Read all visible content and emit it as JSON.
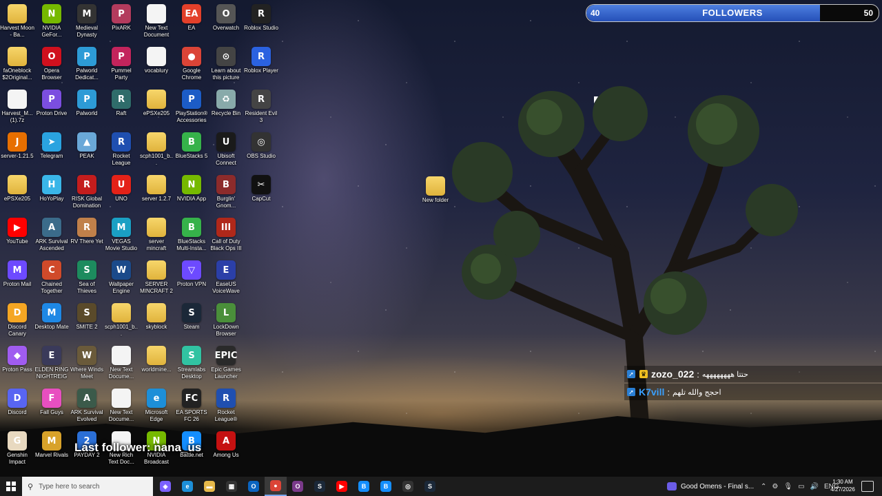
{
  "desktop": {
    "icons": [
      {
        "label": "Harvest Moon - Ba...",
        "glyph": "",
        "color": "#e6b94a",
        "kind": "folder"
      },
      {
        "label": "NVIDIA GeFor...",
        "glyph": "N",
        "color": "#76b900"
      },
      {
        "label": "Medieval Dynasty",
        "glyph": "M",
        "color": "#333"
      },
      {
        "label": "PixARK",
        "glyph": "P",
        "color": "#b33b5d"
      },
      {
        "label": "New Text Document",
        "glyph": "",
        "color": "#eee",
        "kind": "doc"
      },
      {
        "label": "EA",
        "glyph": "EA",
        "color": "#e3402a"
      },
      {
        "label": "Overwatch",
        "glyph": "O",
        "color": "#555"
      },
      {
        "label": "Roblox Studio",
        "glyph": "R",
        "color": "#222"
      },
      {
        "label": "faOneblock $2Original...",
        "glyph": "",
        "color": "#e6b94a",
        "kind": "folder"
      },
      {
        "label": "Opera Browser",
        "glyph": "O",
        "color": "#d0101e"
      },
      {
        "label": "Palworld Dedicat...",
        "glyph": "P",
        "color": "#2d9bd6"
      },
      {
        "label": "Pummel Party",
        "glyph": "P",
        "color": "#c3245c"
      },
      {
        "label": "vocablury",
        "glyph": "",
        "color": "#eee",
        "kind": "doc"
      },
      {
        "label": "Google Chrome",
        "glyph": "●",
        "color": "#db4437"
      },
      {
        "label": "Learn about this picture",
        "glyph": "⊙",
        "color": "#444"
      },
      {
        "label": "Roblox Player",
        "glyph": "R",
        "color": "#2b62e0"
      },
      {
        "label": "Harvest_M... (1).7z",
        "glyph": "",
        "color": "#eee",
        "kind": "doc"
      },
      {
        "label": "Proton Drive",
        "glyph": "P",
        "color": "#7b4ee0"
      },
      {
        "label": "Palworld",
        "glyph": "P",
        "color": "#2d9bd6"
      },
      {
        "label": "Raft",
        "glyph": "R",
        "color": "#2f6c6a"
      },
      {
        "label": "ePSXe205",
        "glyph": "",
        "color": "#e6b94a",
        "kind": "folder"
      },
      {
        "label": "PlayStation® Accessories",
        "glyph": "P",
        "color": "#1c5cc6"
      },
      {
        "label": "Recycle Bin",
        "glyph": "♻",
        "color": "#8aa"
      },
      {
        "label": "Resident Evil 3",
        "glyph": "R",
        "color": "#444"
      },
      {
        "label": "server-1.21.5",
        "glyph": "J",
        "color": "#e76f00"
      },
      {
        "label": "Telegram",
        "glyph": "➤",
        "color": "#2aa3e0"
      },
      {
        "label": "PEAK",
        "glyph": "▲",
        "color": "#6aa8d8"
      },
      {
        "label": "Rocket League",
        "glyph": "R",
        "color": "#1f4fb0"
      },
      {
        "label": "scph1001_b...",
        "glyph": "",
        "color": "#e6b94a",
        "kind": "folder"
      },
      {
        "label": "BlueStacks 5",
        "glyph": "B",
        "color": "#36b24a"
      },
      {
        "label": "Ubisoft Connect",
        "glyph": "U",
        "color": "#1a1a1a"
      },
      {
        "label": "OBS Studio",
        "glyph": "◎",
        "color": "#333"
      },
      {
        "label": "ePSXe205",
        "glyph": "",
        "color": "#e6b94a",
        "kind": "folder"
      },
      {
        "label": "HoYoPlay",
        "glyph": "H",
        "color": "#3ab6e8"
      },
      {
        "label": "RISK Global Domination",
        "glyph": "R",
        "color": "#c41d1d"
      },
      {
        "label": "UNO",
        "glyph": "U",
        "color": "#e42218"
      },
      {
        "label": "server 1.2.7",
        "glyph": "",
        "color": "#e6b94a",
        "kind": "folder"
      },
      {
        "label": "NVIDIA App",
        "glyph": "N",
        "color": "#76b900"
      },
      {
        "label": "Burglin' Gnom...",
        "glyph": "B",
        "color": "#8c2b2b"
      },
      {
        "label": "CapCut",
        "glyph": "✂",
        "color": "#111"
      },
      {
        "label": "YouTube",
        "glyph": "▶",
        "color": "#ff0000"
      },
      {
        "label": "ARK Survival Ascended",
        "glyph": "A",
        "color": "#3b6b8a"
      },
      {
        "label": "RV There Yet",
        "glyph": "R",
        "color": "#c0804a"
      },
      {
        "label": "VEGAS Movie Studio 14 Pl...",
        "glyph": "M",
        "color": "#1aa0c4"
      },
      {
        "label": "server mincraft",
        "glyph": "",
        "color": "#e6b94a",
        "kind": "folder"
      },
      {
        "label": "BlueStacks Multi-Insta...",
        "glyph": "B",
        "color": "#36b24a"
      },
      {
        "label": "Call of Duty Black Ops III",
        "glyph": "III",
        "color": "#b0281a"
      },
      {
        "label": "",
        "glyph": "",
        "color": "",
        "kind": "none"
      },
      {
        "label": "Proton Mail",
        "glyph": "M",
        "color": "#6d4aff"
      },
      {
        "label": "Chained Together",
        "glyph": "C",
        "color": "#d04a2a"
      },
      {
        "label": "Sea of Thieves",
        "glyph": "S",
        "color": "#1d8b5e"
      },
      {
        "label": "Wallpaper Engine",
        "glyph": "W",
        "color": "#1b4a8a"
      },
      {
        "label": "SERVER MINCRAFT 2",
        "glyph": "",
        "color": "#e6b94a",
        "kind": "folder"
      },
      {
        "label": "Proton VPN",
        "glyph": "▽",
        "color": "#6d4aff"
      },
      {
        "label": "EaseUS VoiceWave",
        "glyph": "E",
        "color": "#2b3fa8"
      },
      {
        "label": "",
        "glyph": "",
        "color": "",
        "kind": "none"
      },
      {
        "label": "Discord Canary",
        "glyph": "D",
        "color": "#f5a623"
      },
      {
        "label": "Desktop Mate",
        "glyph": "M",
        "color": "#1e88e5"
      },
      {
        "label": "SMITE 2",
        "glyph": "S",
        "color": "#5a4a2a"
      },
      {
        "label": "scph1001_b...",
        "glyph": "",
        "color": "#e6b94a",
        "kind": "folder"
      },
      {
        "label": "skyblock",
        "glyph": "",
        "color": "#e6b94a",
        "kind": "folder"
      },
      {
        "label": "Steam",
        "glyph": "S",
        "color": "#1b2838"
      },
      {
        "label": "LockDown Browser",
        "glyph": "L",
        "color": "#4a8f3a"
      },
      {
        "label": "",
        "glyph": "",
        "color": "",
        "kind": "none"
      },
      {
        "label": "Proton Pass",
        "glyph": "◆",
        "color": "#a05cf0"
      },
      {
        "label": "ELDEN RING NIGHTREIGN",
        "glyph": "E",
        "color": "#3a3a5a"
      },
      {
        "label": "Where Winds Meet",
        "glyph": "W",
        "color": "#6a5a3a"
      },
      {
        "label": "New Text Docume...",
        "glyph": "",
        "color": "#eee",
        "kind": "doc"
      },
      {
        "label": "worldmine...",
        "glyph": "",
        "color": "#e6b94a",
        "kind": "folder"
      },
      {
        "label": "Streamlabs Desktop",
        "glyph": "S",
        "color": "#31c3a2"
      },
      {
        "label": "Epic Games Launcher",
        "glyph": "EPIC",
        "color": "#2a2a2a"
      },
      {
        "label": "",
        "glyph": "",
        "color": "",
        "kind": "none"
      },
      {
        "label": "Discord",
        "glyph": "D",
        "color": "#5865f2"
      },
      {
        "label": "Fall Guys",
        "glyph": "F",
        "color": "#e84fc0"
      },
      {
        "label": "ARK Survival Evolved",
        "glyph": "A",
        "color": "#3b5a4a"
      },
      {
        "label": "New Text Docume...",
        "glyph": "",
        "color": "#eee",
        "kind": "doc"
      },
      {
        "label": "Microsoft Edge",
        "glyph": "e",
        "color": "#1d8fd8"
      },
      {
        "label": "EA SPORTS FC 26",
        "glyph": "FC",
        "color": "#222"
      },
      {
        "label": "Rocket League®",
        "glyph": "R",
        "color": "#1f4fb0"
      },
      {
        "label": "",
        "glyph": "",
        "color": "",
        "kind": "none"
      },
      {
        "label": "Genshin Impact",
        "glyph": "G",
        "color": "#e8d9c0"
      },
      {
        "label": "Marvel Rivals",
        "glyph": "M",
        "color": "#d8a22a"
      },
      {
        "label": "PAYDAY 2",
        "glyph": "2",
        "color": "#2b6fd6"
      },
      {
        "label": "New Rich Text Doc...",
        "glyph": "",
        "color": "#eee",
        "kind": "doc"
      },
      {
        "label": "NVIDIA Broadcast",
        "glyph": "N",
        "color": "#76b900"
      },
      {
        "label": "Battle.net",
        "glyph": "B",
        "color": "#148eff"
      },
      {
        "label": "Among Us",
        "glyph": "A",
        "color": "#c51111"
      },
      {
        "label": "",
        "glyph": "",
        "color": "",
        "kind": "none"
      }
    ],
    "new_folder_label": "New folder"
  },
  "overlay": {
    "followers_current": "40",
    "followers_goal": "50",
    "followers_title": "FOLLOWERS",
    "followers_progress": 0.8,
    "last_follower": "Last follower: nana_us",
    "chat": [
      {
        "user": "zozo_022",
        "separator": ":",
        "message": "حتتا ههههههههه",
        "user_color": "#ffffff"
      },
      {
        "user": "K7vill",
        "separator": ":",
        "message": "احجج والله تلهم",
        "user_color": "#3aa0ff"
      }
    ]
  },
  "taskbar": {
    "search_placeholder": "Type here to search",
    "apps": [
      {
        "name": "copilot",
        "glyph": "◈",
        "color": "#7b61ff"
      },
      {
        "name": "edge",
        "glyph": "e",
        "color": "#1d8fd8"
      },
      {
        "name": "file-explorer",
        "glyph": "▬",
        "color": "#e6b94a"
      },
      {
        "name": "store",
        "glyph": "▦",
        "color": "#333"
      },
      {
        "name": "outlook",
        "glyph": "O",
        "color": "#0a64c0"
      },
      {
        "name": "chrome",
        "glyph": "●",
        "color": "#db4437",
        "active": true
      },
      {
        "name": "opera-gx",
        "glyph": "O",
        "color": "#7a3a8a"
      },
      {
        "name": "steam",
        "glyph": "S",
        "color": "#1b2838"
      },
      {
        "name": "youtube",
        "glyph": "▶",
        "color": "#ff0000"
      },
      {
        "name": "battle-net",
        "glyph": "B",
        "color": "#148eff"
      },
      {
        "name": "battle-net-2",
        "glyph": "B",
        "color": "#148eff"
      },
      {
        "name": "obs",
        "glyph": "◎",
        "color": "#333"
      },
      {
        "name": "steam-2",
        "glyph": "S",
        "color": "#1b2838"
      }
    ],
    "media_title": "Good Omens - Final s...",
    "language": "ENG",
    "time": "1:30 AM",
    "date": "4/27/2026"
  }
}
